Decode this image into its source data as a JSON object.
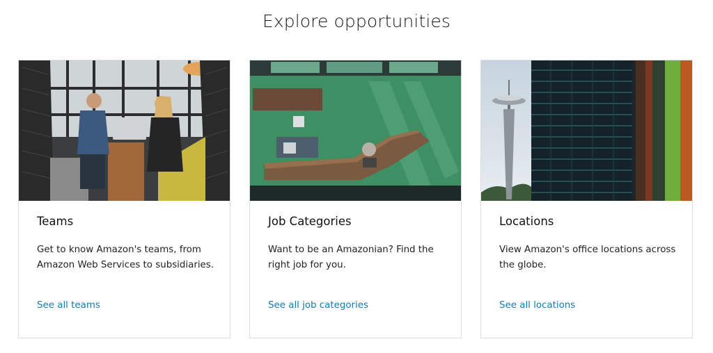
{
  "section": {
    "title": "Explore opportunities"
  },
  "cards": [
    {
      "title": "Teams",
      "description": "Get to know Amazon's teams, from Amazon Web Services to subsidiaries.",
      "link": "See all teams"
    },
    {
      "title": "Job Categories",
      "description": "Want to be an Amazonian? Find the right job for you.",
      "link": "See all job categories"
    },
    {
      "title": "Locations",
      "description": "View Amazon's office locations across the globe.",
      "link": "See all locations"
    }
  ],
  "colors": {
    "link": "#0e7bb3",
    "card_border": "#dcdcdc"
  }
}
